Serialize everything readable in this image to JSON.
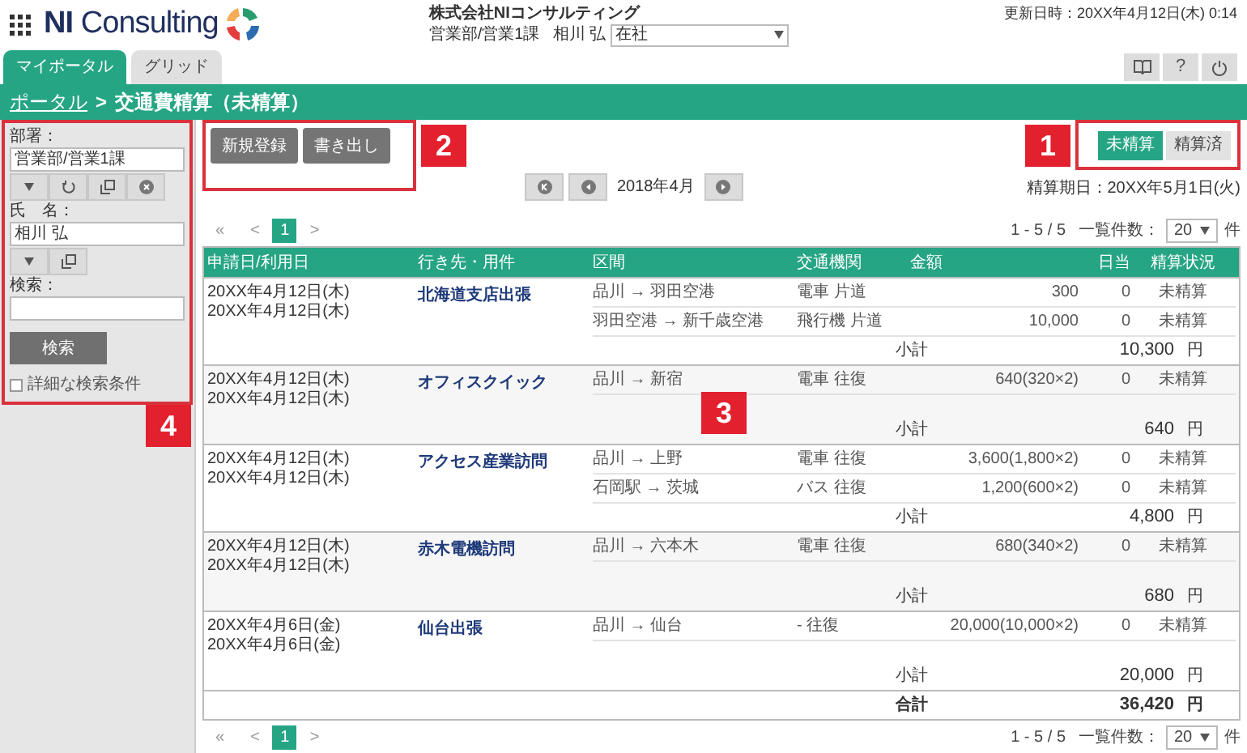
{
  "header": {
    "logo": "**NI** Consulting",
    "company": "株式会社NIコンサルティング",
    "department": "営業部/営業1課",
    "user": "相川 弘",
    "presence": "在社",
    "updated": "更新日時：20XX年4月12日(木) 0:14",
    "help": "?"
  },
  "tabs": [
    {
      "label": "マイポータル",
      "selected": true
    },
    {
      "label": "グリッド",
      "selected": false
    }
  ],
  "breadcrumb": {
    "link": "ポータル",
    "separator": ">",
    "current": "交通費精算（未精算）"
  },
  "sidebar": {
    "department_label": "部署：",
    "department_value": "営業部/営業1課",
    "name_label": "氏　名：",
    "name_value": "相川 弘",
    "search_label": "検索：",
    "search_button": "検索",
    "advanced_label": "詳細な検索条件",
    "advanced_checked": false
  },
  "actions": [
    "新規登録",
    "書き出し"
  ],
  "month": "2018年4月",
  "status_filter": [
    {
      "label": "未精算",
      "selected": true
    },
    {
      "label": "精算済",
      "selected": false
    }
  ],
  "due_date": "精算期日：20XX年5月1日(火)",
  "pager_top": {
    "first": "«",
    "prev": "<",
    "pages": [
      {
        "label": "1",
        "selected": true
      }
    ],
    "next": ">",
    "range": "1 - 5 / 5",
    "per_page_label": "一覧件数：",
    "per_page": "20",
    "unit": "件"
  },
  "table": {
    "columns": [
      "申請日/利用日",
      "行き先・用件",
      "区間",
      "交通機関",
      "金額",
      "日当",
      "精算状況"
    ],
    "groups": [
      {
        "dates": [
          "20XX年4月12日(木)",
          "20XX年4月12日(木)"
        ],
        "destination": "北海道支店出張",
        "legs": [
          {
            "section": "品川 → 羽田空港",
            "transport": "電車 片道",
            "amount": "300",
            "allowance": "0",
            "status": "未精算"
          },
          {
            "section": "羽田空港 → 新千歳空港",
            "transport": "飛行機 片道",
            "amount": "10,000",
            "allowance": "0",
            "status": "未精算"
          }
        ],
        "subtotal_label": "小計",
        "subtotal": "10,300",
        "currency": "円"
      },
      {
        "dates": [
          "20XX年4月12日(木)",
          "20XX年4月12日(木)"
        ],
        "destination": "オフィスクイック",
        "legs": [
          {
            "section": "品川 → 新宿",
            "transport": "電車 往復",
            "amount": "640(320×2)",
            "allowance": "0",
            "status": "未精算"
          }
        ],
        "subtotal_label": "小計",
        "subtotal": "640",
        "currency": "円"
      },
      {
        "dates": [
          "20XX年4月12日(木)",
          "20XX年4月12日(木)"
        ],
        "destination": "アクセス産業訪問",
        "legs": [
          {
            "section": "品川 → 上野",
            "transport": "電車 往復",
            "amount": "3,600(1,800×2)",
            "allowance": "0",
            "status": "未精算"
          },
          {
            "section": "石岡駅 → 茨城",
            "transport": "バス 往復",
            "amount": "1,200(600×2)",
            "allowance": "0",
            "status": "未精算"
          }
        ],
        "subtotal_label": "小計",
        "subtotal": "4,800",
        "currency": "円"
      },
      {
        "dates": [
          "20XX年4月12日(木)",
          "20XX年4月12日(木)"
        ],
        "destination": "赤木電機訪問",
        "legs": [
          {
            "section": "品川 → 六本木",
            "transport": "電車 往復",
            "amount": "680(340×2)",
            "allowance": "0",
            "status": "未精算"
          }
        ],
        "subtotal_label": "小計",
        "subtotal": "680",
        "currency": "円"
      },
      {
        "dates": [
          "20XX年4月6日(金)",
          "20XX年4月6日(金)"
        ],
        "destination": "仙台出張",
        "legs": [
          {
            "section": "品川 → 仙台",
            "transport": "- 往復",
            "amount": "20,000(10,000×2)",
            "allowance": "0",
            "status": "未精算"
          }
        ],
        "subtotal_label": "小計",
        "subtotal": "20,000",
        "currency": "円"
      }
    ],
    "total": {
      "label": "合計",
      "value": "36,420",
      "currency": "円"
    }
  },
  "pager_bottom": {
    "first": "«",
    "prev": "<",
    "pages": [
      {
        "label": "1",
        "selected": true
      }
    ],
    "next": ">",
    "range": "1 - 5 / 5",
    "per_page_label": "一覧件数：",
    "per_page": "20",
    "unit": "件"
  },
  "callouts": [
    "1",
    "2",
    "3",
    "4"
  ]
}
